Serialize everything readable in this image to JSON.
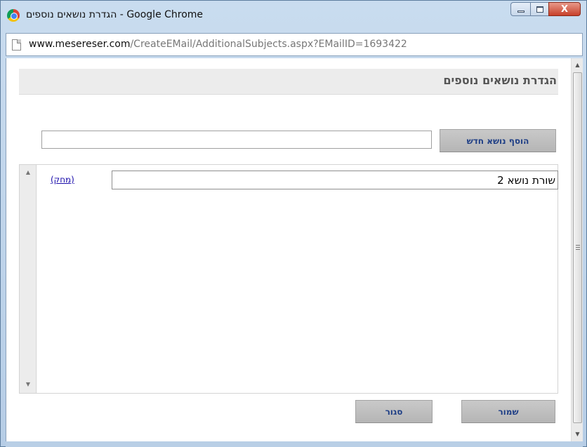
{
  "window": {
    "title_rtl": "הגדרת נושאים נוספים",
    "title_separator": " - ",
    "title_app": "Google Chrome",
    "controls": {
      "close_label": "X"
    }
  },
  "addressbar": {
    "url_host": "www.mesereser.com",
    "url_path": "/CreateEMail/AdditionalSubjects.aspx?EMailID=1693422"
  },
  "page": {
    "title": "הגדרת נושאים נוספים",
    "new_subject": {
      "value": "",
      "placeholder": ""
    },
    "add_button_label": "הוסף נושא חדש",
    "subjects": [
      {
        "value": "שורת נושא 2",
        "delete_label": "(מחק)"
      }
    ],
    "save_button_label": "שמור",
    "close_button_label": "סגור"
  },
  "icons": {
    "app": "chrome-icon",
    "page": "page-icon",
    "scroll_up": "scroll-up-icon",
    "scroll_down": "scroll-down-icon"
  },
  "colors": {
    "button_text": "#1f3f86",
    "link": "#1a0dab",
    "header_band": "#ececec",
    "frame": "#c9dcef"
  }
}
